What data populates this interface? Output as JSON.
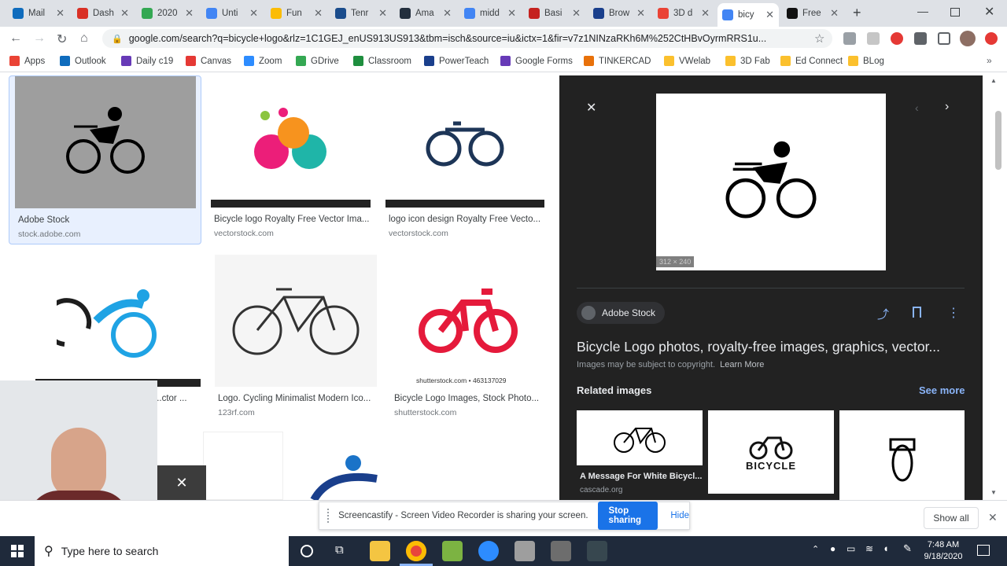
{
  "tabs": [
    {
      "label": "Mail",
      "color": "#0f6cbd"
    },
    {
      "label": "Dash",
      "color": "#d93025"
    },
    {
      "label": "2020",
      "color": "#34a853"
    },
    {
      "label": "Unti",
      "color": "#4285f4"
    },
    {
      "label": "Fun",
      "color": "#fbbc04"
    },
    {
      "label": "Tenr",
      "color": "#1a4c8c"
    },
    {
      "label": "Ama",
      "color": "#232f3e"
    },
    {
      "label": "midd",
      "color": "#4285f4"
    },
    {
      "label": "Basi",
      "color": "#c5221f"
    },
    {
      "label": "Brow",
      "color": "#1a3f8c"
    },
    {
      "label": "3D d",
      "color": "#ea4335"
    },
    {
      "label": "bicy",
      "color": "#4285f4"
    },
    {
      "label": "Free",
      "color": "#111111"
    }
  ],
  "url": "google.com/search?q=bicycle+logo&rlz=1C1GEJ_enUS913US913&tbm=isch&source=iu&ictx=1&fir=v7z1NINzaRKh6M%252CtHBvOyrmRRS1u...",
  "bookmarks": [
    {
      "label": "Apps",
      "color": "#ea4335"
    },
    {
      "label": "Outlook",
      "color": "#0f6cbd"
    },
    {
      "label": "Daily c19",
      "color": "#673ab7"
    },
    {
      "label": "Canvas",
      "color": "#e53935"
    },
    {
      "label": "Zoom",
      "color": "#2d8cff"
    },
    {
      "label": "GDrive",
      "color": "#34a853"
    },
    {
      "label": "Classroom",
      "color": "#1e8e3e"
    },
    {
      "label": "PowerTeach",
      "color": "#1a3f8c"
    },
    {
      "label": "Google Forms",
      "color": "#673ab7"
    },
    {
      "label": "TINKERCAD",
      "color": "#e8710a"
    },
    {
      "label": "VWelab",
      "color": "#fbc02d"
    },
    {
      "label": "3D Fab",
      "color": "#fbc02d"
    },
    {
      "label": "Ed Connect",
      "color": "#fbc02d"
    },
    {
      "label": "BLog",
      "color": "#fbc02d"
    }
  ],
  "results": [
    {
      "title": "Adobe Stock",
      "source": "stock.adobe.com"
    },
    {
      "title": "Bicycle logo Royalty Free Vector Ima...",
      "source": "vectorstock.com"
    },
    {
      "title": "logo icon design Royalty Free Vecto...",
      "source": "vectorstock.com"
    },
    {
      "title": "...ctor ...",
      "source": ""
    },
    {
      "title": "Logo. Cycling Minimalist Modern Ico...",
      "source": "123rf.com"
    },
    {
      "title": "Bicycle Logo Images, Stock Photo...",
      "source": "shutterstock.com"
    }
  ],
  "thumb_watermark": "shutterstock.com • 463137029",
  "panel": {
    "image_size": "312 × 240",
    "source_name": "Adobe Stock",
    "title": "Bicycle Logo photos, royalty-free images, graphics, vector...",
    "copyright": "Images may be subject to copyright.",
    "learn_more": "Learn More",
    "related_heading": "Related images",
    "see_more": "See more",
    "related": [
      {
        "caption": "A Message For White Bicycl...",
        "source": "cascade.org"
      },
      {
        "caption": "BICYCLE",
        "source": ""
      },
      {
        "caption": "",
        "source": ""
      }
    ]
  },
  "screencastify": {
    "message": "Screencastify - Screen Video Recorder is sharing your screen.",
    "stop": "Stop sharing",
    "hide": "Hide"
  },
  "show_all": "Show all",
  "taskbar": {
    "search_placeholder": "Type here to search",
    "time": "7:48 AM",
    "date": "9/18/2020"
  }
}
